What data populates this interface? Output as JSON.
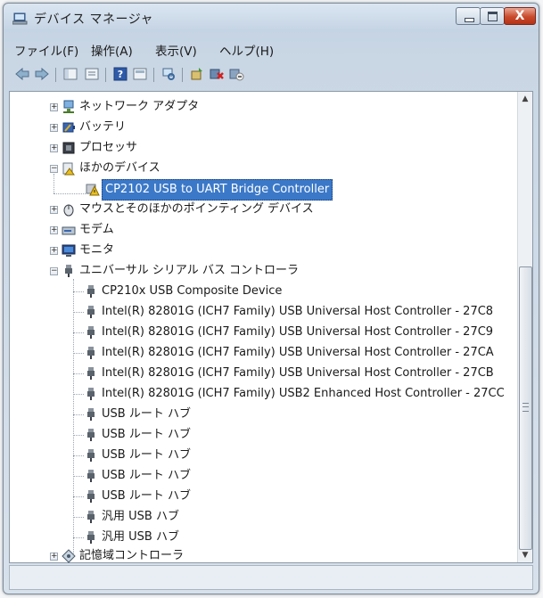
{
  "window": {
    "title": "デバイス マネージャ",
    "close_glyph": "X"
  },
  "menu": [
    {
      "label": "ファイル(F)"
    },
    {
      "label": "操作(A)"
    },
    {
      "label": "表示(V)"
    },
    {
      "label": "ヘルプ(H)"
    }
  ],
  "toolbar": {
    "icons": [
      "back-arrow-icon",
      "forward-arrow-icon",
      "show-hide-console-tree-icon",
      "properties-icon",
      "help-icon",
      "view-icon",
      "scan-hardware-icon",
      "update-driver-icon",
      "uninstall-icon",
      "disable-device-icon"
    ]
  },
  "tree": {
    "categories": {
      "network": "ネットワーク アダプタ",
      "battery": "バッテリ",
      "processor": "プロセッサ",
      "other_devices": "ほかのデバイス",
      "cp2102": "CP2102 USB to UART Bridge Controller",
      "mouse": "マウスとそのほかのポインティング デバイス",
      "modem": "モデム",
      "monitor": "モニタ",
      "usb": "ユニバーサル シリアル バス コントローラ",
      "storage": "記憶域コントローラ"
    },
    "usb_children": [
      "CP210x USB Composite Device",
      "Intel(R) 82801G (ICH7 Family) USB Universal Host Controller - 27C8",
      "Intel(R) 82801G (ICH7 Family) USB Universal Host Controller - 27C9",
      "Intel(R) 82801G (ICH7 Family) USB Universal Host Controller - 27CA",
      "Intel(R) 82801G (ICH7 Family) USB Universal Host Controller - 27CB",
      "Intel(R) 82801G (ICH7 Family) USB2 Enhanced Host Controller - 27CC",
      "USB ルート ハブ",
      "USB ルート ハブ",
      "USB ルート ハブ",
      "USB ルート ハブ",
      "USB ルート ハブ",
      "汎用 USB ハブ",
      "汎用 USB ハブ"
    ],
    "expander_plus": "+",
    "expander_minus": "−",
    "selection_color": "#3b78c8",
    "warning_color": "#e8c020"
  },
  "statusbar": {
    "text": ""
  }
}
